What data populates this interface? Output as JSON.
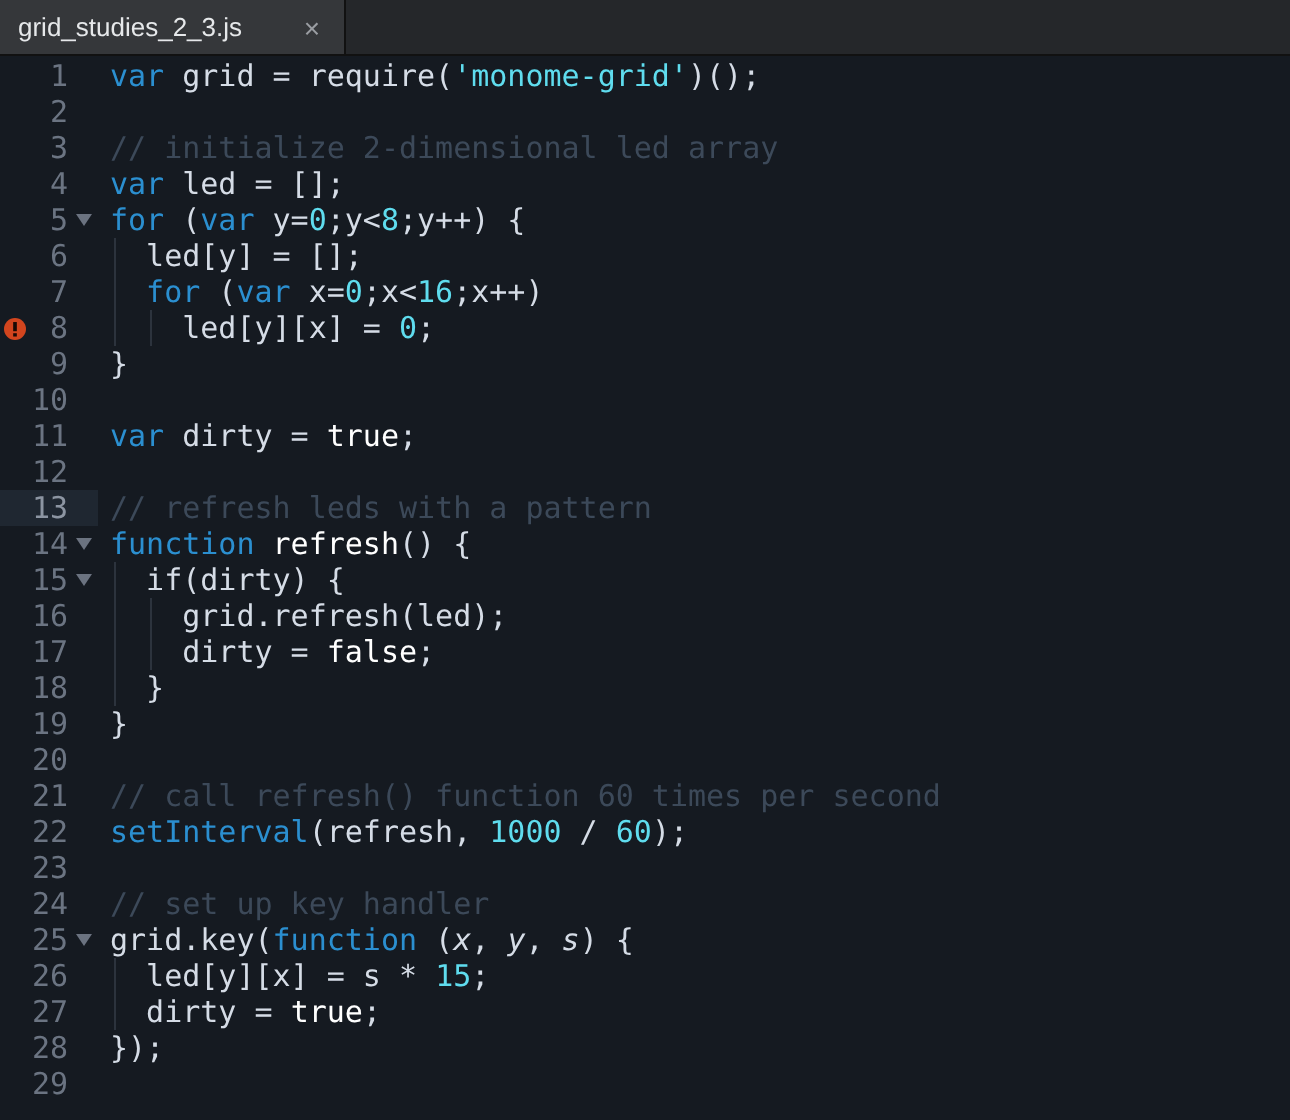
{
  "tabs": [
    {
      "title": "grid_studies_2_3.js",
      "close": "×",
      "selected": true
    }
  ],
  "lines": [
    {
      "number": "1",
      "tokens": [
        {
          "kind": "kw",
          "text": "var"
        },
        {
          "kind": "id",
          "text": " grid = require("
        },
        {
          "kind": "str",
          "text": "'monome-grid'"
        },
        {
          "kind": "id",
          "text": ")();"
        }
      ]
    },
    {
      "number": "2"
    },
    {
      "number": "3",
      "tokens": [
        {
          "kind": "com",
          "text": "// initialize 2-dimensional led array"
        }
      ]
    },
    {
      "number": "4",
      "tokens": [
        {
          "kind": "kw",
          "text": "var"
        },
        {
          "kind": "id",
          "text": " led = [];"
        }
      ]
    },
    {
      "number": "5",
      "fold": true,
      "tokens": [
        {
          "kind": "kw",
          "text": "for"
        },
        {
          "kind": "id",
          "text": " ("
        },
        {
          "kind": "kw",
          "text": "var"
        },
        {
          "kind": "id",
          "text": " y="
        },
        {
          "kind": "num",
          "text": "0"
        },
        {
          "kind": "id",
          "text": ";y<"
        },
        {
          "kind": "num",
          "text": "8"
        },
        {
          "kind": "id",
          "text": ";y++) {"
        }
      ]
    },
    {
      "number": "6",
      "tokens": [
        {
          "kind": "id",
          "text": "  led[y] = [];"
        }
      ]
    },
    {
      "number": "7",
      "tokens": [
        {
          "kind": "kw",
          "text": "  for"
        },
        {
          "kind": "id",
          "text": " ("
        },
        {
          "kind": "kw",
          "text": "var"
        },
        {
          "kind": "id",
          "text": " x="
        },
        {
          "kind": "num",
          "text": "0"
        },
        {
          "kind": "id",
          "text": ";x<"
        },
        {
          "kind": "num",
          "text": "16"
        },
        {
          "kind": "id",
          "text": ";x++)"
        }
      ]
    },
    {
      "number": "8",
      "error": true,
      "tokens": [
        {
          "kind": "id",
          "text": "    led[y][x] = "
        },
        {
          "kind": "num",
          "text": "0"
        },
        {
          "kind": "id",
          "text": ";"
        }
      ]
    },
    {
      "number": "9",
      "tokens": [
        {
          "kind": "id",
          "text": "}"
        }
      ]
    },
    {
      "number": "10"
    },
    {
      "number": "11",
      "tokens": [
        {
          "kind": "kw",
          "text": "var"
        },
        {
          "kind": "id",
          "text": " dirty = "
        },
        {
          "kind": "lit",
          "text": "true"
        },
        {
          "kind": "id",
          "text": ";"
        }
      ]
    },
    {
      "number": "12"
    },
    {
      "number": "13",
      "current": true,
      "tokens": [
        {
          "kind": "com",
          "text": "// refresh leds with a pattern"
        }
      ]
    },
    {
      "number": "14",
      "fold": true,
      "tokens": [
        {
          "kind": "kw",
          "text": "function"
        },
        {
          "kind": "lit",
          "text": " refresh"
        },
        {
          "kind": "id",
          "text": "() {"
        }
      ]
    },
    {
      "number": "15",
      "fold": true,
      "tokens": [
        {
          "kind": "id",
          "text": "  if(dirty) {"
        }
      ]
    },
    {
      "number": "16",
      "tokens": [
        {
          "kind": "id",
          "text": "    grid.refresh(led);"
        }
      ]
    },
    {
      "number": "17",
      "tokens": [
        {
          "kind": "id",
          "text": "    dirty = "
        },
        {
          "kind": "lit",
          "text": "false"
        },
        {
          "kind": "id",
          "text": ";"
        }
      ]
    },
    {
      "number": "18",
      "tokens": [
        {
          "kind": "id",
          "text": "  }"
        }
      ]
    },
    {
      "number": "19",
      "tokens": [
        {
          "kind": "id",
          "text": "}"
        }
      ]
    },
    {
      "number": "20"
    },
    {
      "number": "21",
      "tokens": [
        {
          "kind": "com",
          "text": "// call refresh() function 60 times per second"
        }
      ]
    },
    {
      "number": "22",
      "tokens": [
        {
          "kind": "kw",
          "text": "setInterval"
        },
        {
          "kind": "id",
          "text": "(refresh, "
        },
        {
          "kind": "num",
          "text": "1000"
        },
        {
          "kind": "id",
          "text": " / "
        },
        {
          "kind": "num",
          "text": "60"
        },
        {
          "kind": "id",
          "text": ");"
        }
      ]
    },
    {
      "number": "23"
    },
    {
      "number": "24",
      "tokens": [
        {
          "kind": "com",
          "text": "// set up key handler"
        }
      ]
    },
    {
      "number": "25",
      "fold": true,
      "tokens": [
        {
          "kind": "id",
          "text": "grid.key("
        },
        {
          "kind": "kw",
          "text": "function"
        },
        {
          "kind": "id",
          "text": " ("
        },
        {
          "kind": "param",
          "text": "x"
        },
        {
          "kind": "id",
          "text": ", "
        },
        {
          "kind": "param",
          "text": "y"
        },
        {
          "kind": "id",
          "text": ", "
        },
        {
          "kind": "param",
          "text": "s"
        },
        {
          "kind": "id",
          "text": ") {"
        }
      ]
    },
    {
      "number": "26",
      "tokens": [
        {
          "kind": "id",
          "text": "  led[y][x] = s * "
        },
        {
          "kind": "num",
          "text": "15"
        },
        {
          "kind": "id",
          "text": ";"
        }
      ]
    },
    {
      "number": "27",
      "tokens": [
        {
          "kind": "id",
          "text": "  dirty = "
        },
        {
          "kind": "lit",
          "text": "true"
        },
        {
          "kind": "id",
          "text": ";"
        }
      ]
    },
    {
      "number": "28",
      "tokens": [
        {
          "kind": "id",
          "text": "});"
        }
      ]
    },
    {
      "number": "29"
    }
  ]
}
